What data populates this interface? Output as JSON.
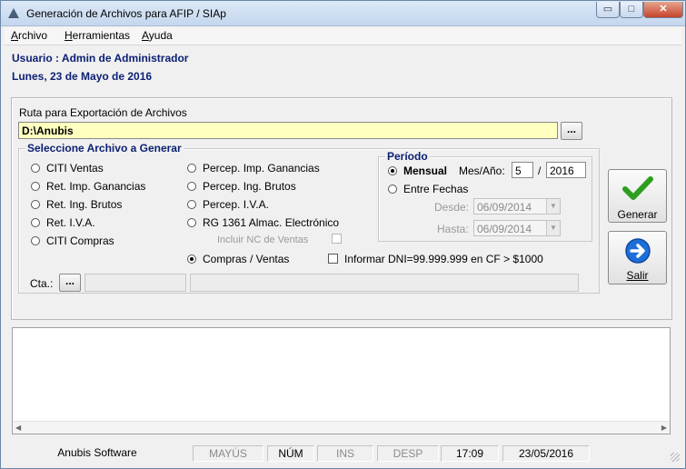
{
  "window": {
    "title": "Generación de Archivos para AFIP / SIAp",
    "controls": {
      "minimize": "▭",
      "maximize": "□",
      "close": "✕"
    }
  },
  "menu": [
    "Archivo",
    "Herramientas",
    "Ayuda"
  ],
  "header": {
    "user": "Usuario : Admin de Administrador",
    "date": "Lunes, 23 de Mayo de 2016"
  },
  "export": {
    "label": "Ruta para Exportación de Archivos",
    "path": "D:\\Anubis",
    "browse_label": "..."
  },
  "file_selection": {
    "title": "Seleccione Archivo a Generar",
    "left_options": [
      "CITI Ventas",
      "Ret. Imp. Ganancias",
      "Ret. Ing. Brutos",
      "Ret. I.V.A.",
      "CITI Compras"
    ],
    "right_options": [
      "Percep. Imp. Ganancias",
      "Percep. Ing. Brutos",
      "Percep. I.V.A.",
      "RG 1361 Almac. Electrónico"
    ],
    "include_nc_label": "Incluir NC de Ventas",
    "compras_ventas_label": "Compras / Ventas",
    "selected": "Compras / Ventas",
    "informar_dni_label": "Informar DNI=99.999.999 en CF > $1000",
    "cta_label": "Cta.:",
    "cta_button": "..."
  },
  "period": {
    "title": "Período",
    "mensual_label": "Mensual",
    "mes_anio_label": "Mes/Año:",
    "month": "5",
    "separator": "/",
    "year": "2016",
    "entre_fechas_label": "Entre Fechas",
    "desde_label": "Desde:",
    "desde_value": "06/09/2014",
    "hasta_label": "Hasta:",
    "hasta_value": "06/09/2014",
    "selected": "Mensual"
  },
  "actions": {
    "generar_label": "Generar",
    "salir_label": "Salir"
  },
  "status_bar": {
    "company": "Anubis Software",
    "mayus": "MAYÚS",
    "num": "NÚM",
    "ins": "INS",
    "desp": "DESP",
    "time": "17:09",
    "date": "23/05/2016"
  },
  "colors": {
    "heading_blue": "#0b1f73",
    "path_background": "#ffffc0",
    "check_green": "#2e9e1f",
    "arrow_blue": "#1d6fd8"
  }
}
